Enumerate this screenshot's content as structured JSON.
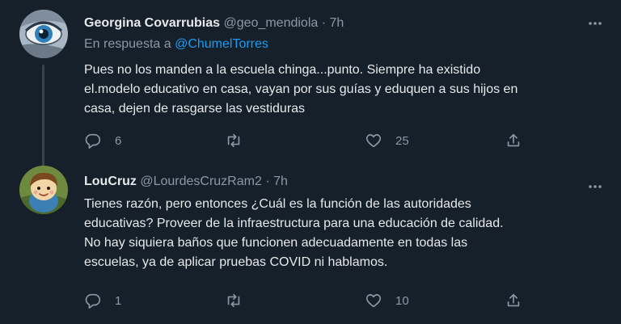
{
  "tweets": [
    {
      "author_name": "Georgina Covarrubias",
      "handle": "@geo_mendiola",
      "separator": "·",
      "time": "7h",
      "reply_prefix": "En respuesta a ",
      "reply_to": "@ChumelTorres",
      "text": "Pues no los manden a la escuela chinga...punto. Siempre ha existido\nel.modelo educativo en casa, vayan por sus guías y eduquen a sus hijos en\ncasa, dejen de rasgarse las vestiduras",
      "replies": "6",
      "retweets": "",
      "likes": "25"
    },
    {
      "author_name": "LouCruz",
      "handle": "@LourdesCruzRam2",
      "separator": "·",
      "time": "7h",
      "text": "Tienes razón, pero entonces ¿Cuál es la función de las autoridades\neducativas? Proveer de la infraestructura para una educación de calidad.\nNo hay siquiera baños que funcionen adecuadamente en todas las\nescuelas, ya de aplicar pruebas COVID ni hablamos.",
      "replies": "1",
      "retweets": "",
      "likes": "10"
    }
  ],
  "icons": {
    "reply": "reply-icon",
    "retweet": "retweet-icon",
    "like": "heart-icon",
    "share": "share-icon",
    "more": "more-icon"
  },
  "colors": {
    "background": "#15202b",
    "text_primary": "#e7e9ea",
    "text_secondary": "#8b98a5",
    "link": "#1d9bf0",
    "thread_line": "#38444d"
  }
}
